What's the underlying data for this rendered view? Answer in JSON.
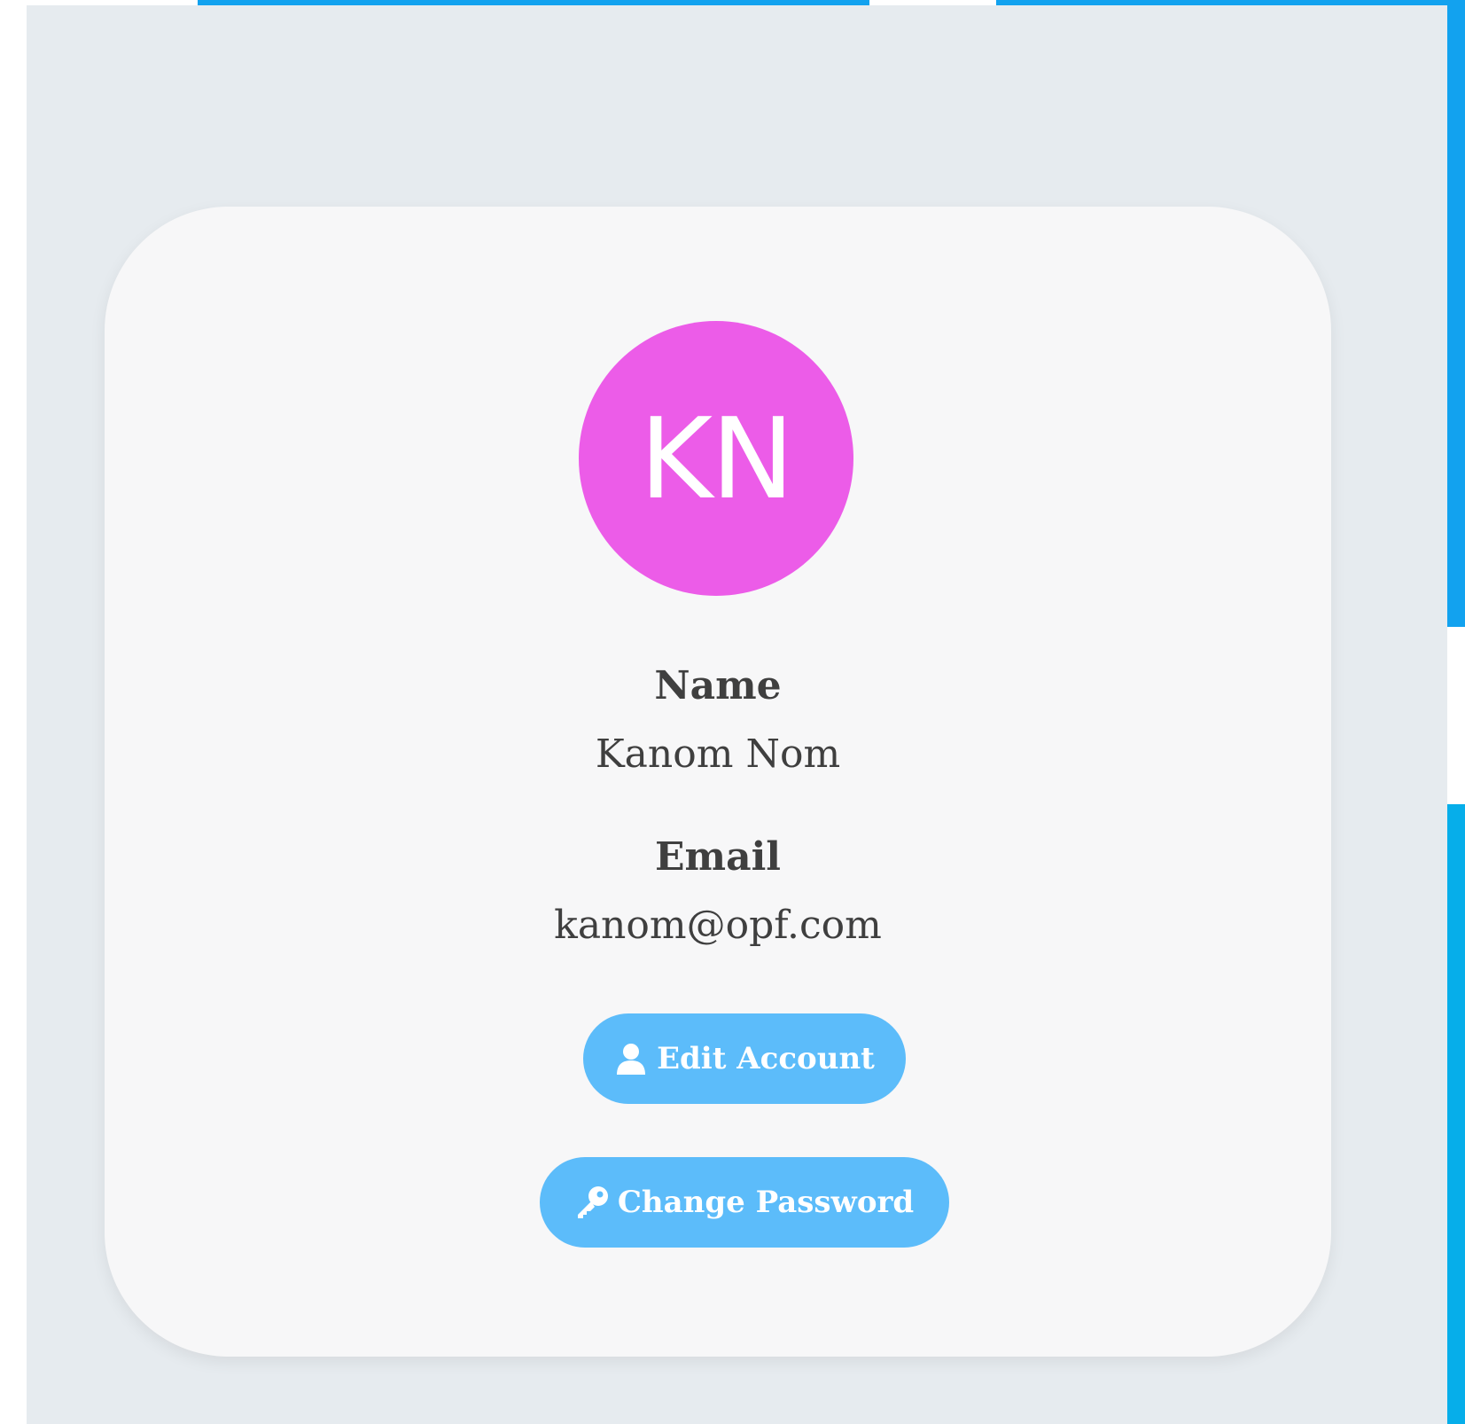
{
  "profile": {
    "avatar_initials": "KN",
    "avatar_color": "#ec5ce8",
    "name_label": "Name",
    "name_value": "Kanom Nom",
    "email_label": "Email",
    "email_value": "kanom@opf.com"
  },
  "actions": {
    "edit_account_label": "Edit Account",
    "edit_account_icon": "user-icon",
    "change_password_label": "Change Password",
    "change_password_icon": "key-icon"
  },
  "colors": {
    "accent_blue": "#12a2ef",
    "button_blue": "#5cbcfa",
    "panel_bg": "#e6ebef",
    "card_bg": "#f7f7f8",
    "text": "#3f3f3f"
  }
}
